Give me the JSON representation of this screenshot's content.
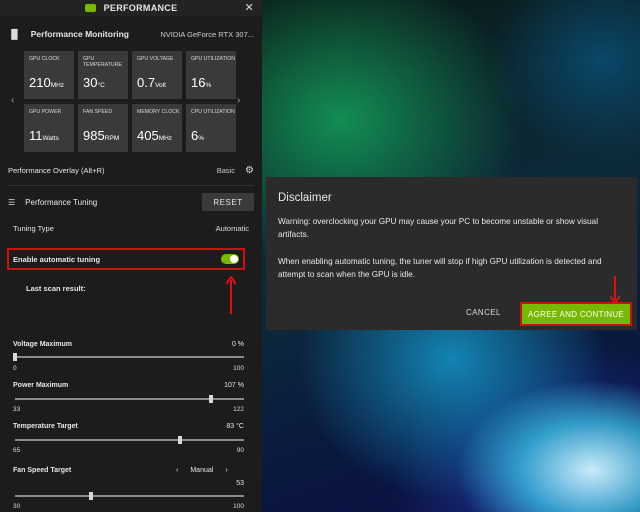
{
  "panel": {
    "title": "PERFORMANCE",
    "monitoring_title": "Performance Monitoring",
    "gpu_name": "NVIDIA GeForce RTX 307...",
    "tiles": [
      {
        "label": "GPU CLOCK",
        "value": "210",
        "unit": "MHz"
      },
      {
        "label": "GPU TEMPERATURE",
        "value": "30",
        "unit": "°C"
      },
      {
        "label": "GPU VOLTAGE",
        "value": "0.7",
        "unit": "Volt"
      },
      {
        "label": "GPU UTILIZATION",
        "value": "16",
        "unit": "%"
      },
      {
        "label": "GPU POWER",
        "value": "11",
        "unit": "Watts"
      },
      {
        "label": "FAN SPEED",
        "value": "985",
        "unit": "RPM"
      },
      {
        "label": "MEMORY CLOCK",
        "value": "405",
        "unit": "MHz"
      },
      {
        "label": "CPU UTILIZATION",
        "value": "6",
        "unit": "%"
      }
    ],
    "overlay_label": "Performance Overlay (Alt+R)",
    "overlay_mode": "Basic",
    "tuning_title": "Performance Tuning",
    "reset_label": "RESET",
    "tuning_type_label": "Tuning Type",
    "tuning_type_value": "Automatic",
    "auto_tuning_label": "Enable automatic tuning",
    "auto_tuning_on": true,
    "last_scan_label": "Last scan result:",
    "sliders": [
      {
        "label": "Voltage Maximum",
        "value": "0 %",
        "min": "0",
        "max": "100",
        "fraction": 0.0
      },
      {
        "label": "Power Maximum",
        "value": "107 %",
        "min": "33",
        "max": "122",
        "fraction": 0.854
      },
      {
        "label": "Temperature Target",
        "value": "83 °C",
        "min": "65",
        "max": "90",
        "fraction": 0.72
      },
      {
        "label": "Fan Speed Target",
        "value": "53",
        "min": "30",
        "max": "100",
        "fraction": 0.33
      }
    ],
    "fan_mode": "Manual"
  },
  "dialog": {
    "title": "Disclaimer",
    "paragraph1": "Warning: overclocking your GPU may cause your PC to become unstable or show visual artifacts.",
    "paragraph2": "When enabling automatic tuning, the tuner will stop if high GPU utilization is detected and attempt to scan when the GPU is idle.",
    "cancel_label": "CANCEL",
    "agree_label": "AGREE AND CONTINUE"
  },
  "colors": {
    "accent": "#76b900",
    "highlight": "#d00f0f",
    "panel_bg": "#1c1c1c",
    "dialog_bg": "#2b2b2b"
  }
}
